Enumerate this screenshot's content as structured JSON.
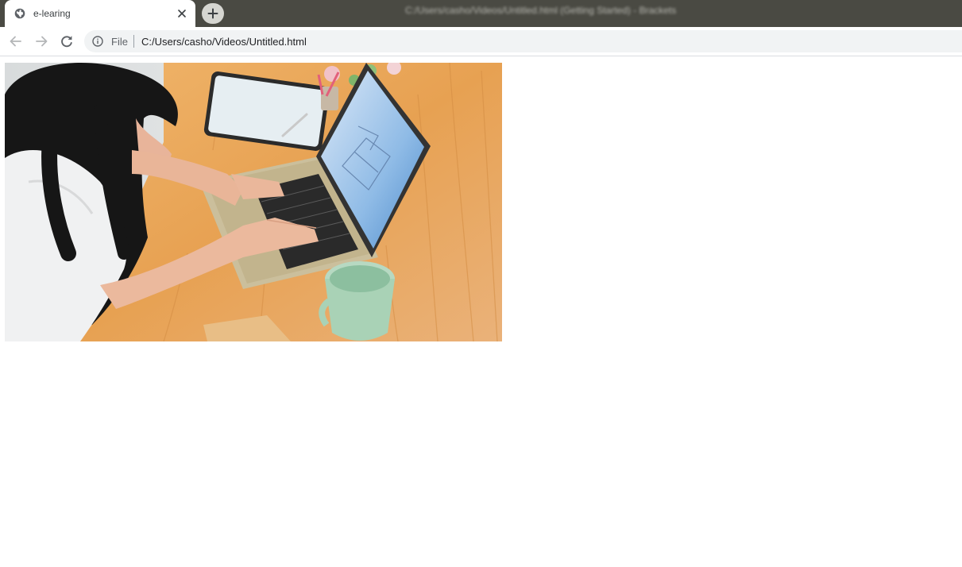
{
  "window": {
    "title": "C:/Users/casho/Videos/Untitled.html (Getting Started) - Brackets"
  },
  "tab": {
    "title": "e-learing",
    "favicon": "globe-icon",
    "close_icon": "close-icon"
  },
  "new_tab": {
    "icon": "plus-icon"
  },
  "toolbar": {
    "back_icon": "arrow-left-icon",
    "forward_icon": "arrow-right-icon",
    "reload_icon": "reload-icon",
    "info_icon": "info-icon",
    "scheme": "File",
    "url": "C:/Users/casho/Videos/Untitled.html"
  },
  "colors": {
    "titlebar": "#4a4a43",
    "omnibox": "#f1f3f4",
    "table_wood": "#e9a55a"
  }
}
